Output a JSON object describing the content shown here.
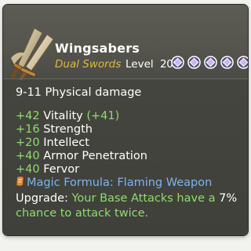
{
  "item": {
    "name": "Wingsabers",
    "subtype": "Dual Swords",
    "level_label": "Level",
    "level": "20",
    "upgrade_stars": 5,
    "colors": {
      "name": "#ffffff",
      "subtype": "#e2b83a",
      "stat_green": "#8fdc6b",
      "formula_blue": "#7ab4f0",
      "star_fill": "#c9b8f0"
    }
  },
  "damage": "9-11 Physical damage",
  "stats": [
    {
      "value": "+42",
      "name": "Vitality",
      "bonus": "(+41)"
    },
    {
      "value": "+16",
      "name": "Strength",
      "bonus": ""
    },
    {
      "value": "+20",
      "name": "Intellect",
      "bonus": ""
    },
    {
      "value": "+40",
      "name": "Armor Penetration",
      "bonus": ""
    },
    {
      "value": "+40",
      "name": "Fervor",
      "bonus": ""
    }
  ],
  "magic_formula": "Magic Formula: Flaming Weapon",
  "upgrade": {
    "label": "Upgrade:",
    "text_before": "Your Base Attacks have a",
    "chance": "7%",
    "text_after": "chance to attack twice."
  }
}
